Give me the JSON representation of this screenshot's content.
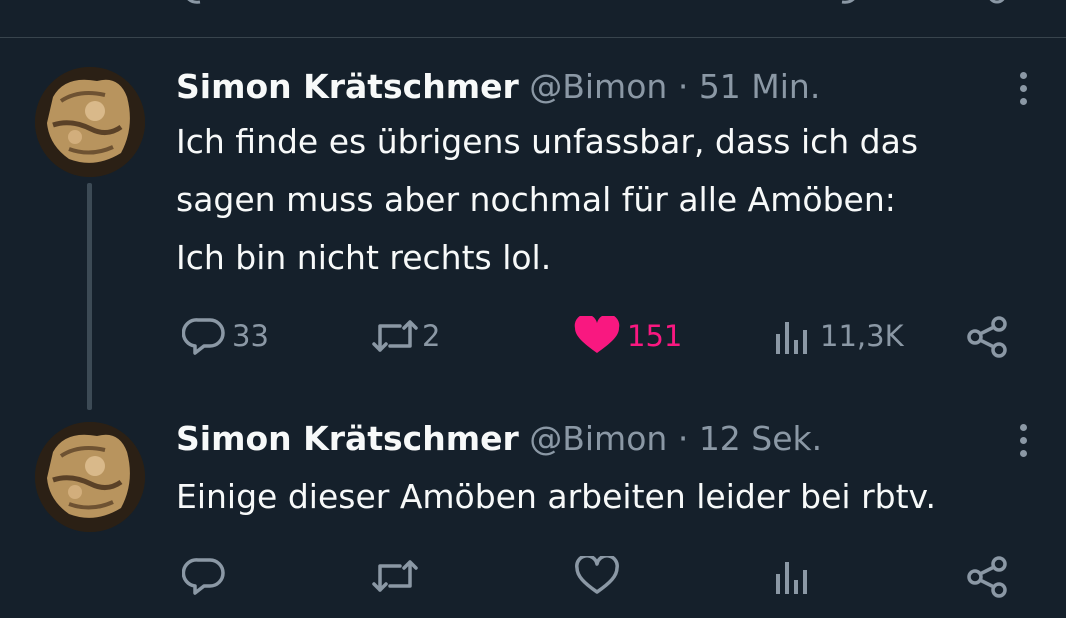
{
  "colors": {
    "background": "#15202b",
    "text": "#f7f9f9",
    "muted": "#8b98a5",
    "like": "#f91880",
    "divider": "#38444d"
  },
  "tweets": [
    {
      "author_name": "Simon Krätschmer",
      "handle": "@Bimon",
      "separator": "·",
      "time": "51 Min.",
      "text_lines": [
        "Ich finde es übrigens unfassbar, dass ich das",
        "sagen muss aber nochmal für alle Amöben:",
        "Ich bin nicht rechts lol."
      ],
      "replies": "33",
      "retweets": "2",
      "likes": "151",
      "liked": true,
      "views": "11,3K"
    },
    {
      "author_name": "Simon Krätschmer",
      "handle": "@Bimon",
      "separator": "·",
      "time": "12 Sek.",
      "text_lines": [
        "Einige dieser Amöben arbeiten leider bei rbtv."
      ],
      "liked": false
    }
  ],
  "icons": [
    "reply-icon",
    "retweet-icon",
    "like-icon",
    "views-icon",
    "share-icon",
    "more-icon"
  ]
}
